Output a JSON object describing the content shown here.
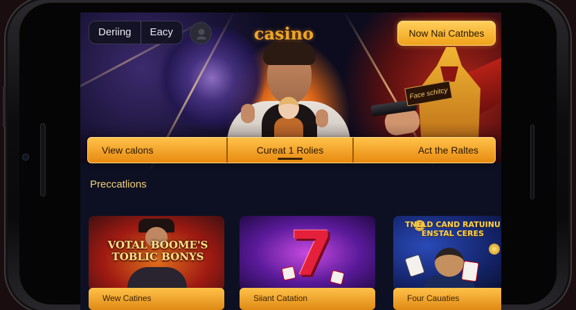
{
  "header": {
    "tab_left": "Deriing",
    "tab_right": "Eacy",
    "logo": "casino",
    "cta_button": "Now Nai Catnbes"
  },
  "hero": {
    "knight_banner": "Face schitcy"
  },
  "nav": {
    "items": [
      {
        "label": "View calons",
        "active": false
      },
      {
        "label": "Cureat 1 Rolies",
        "active": true
      },
      {
        "label": "Act the Raltes",
        "active": false
      }
    ]
  },
  "section": {
    "title": "Preccatlions"
  },
  "cards": [
    {
      "title": "VOTAL BOOME'S TOBLIC BONYS",
      "label": "Wew Catines"
    },
    {
      "title": "7",
      "label": "Siiant Catation"
    },
    {
      "title": "TNELD CAND RATUINU ENSTAL CERES",
      "label": "Four Cauaties"
    }
  ],
  "colors": {
    "accent": "#f0a21a",
    "section_title": "#f2d178",
    "screen_bg": "#0d1022"
  },
  "icons": {
    "circle_button": "user-icon"
  }
}
